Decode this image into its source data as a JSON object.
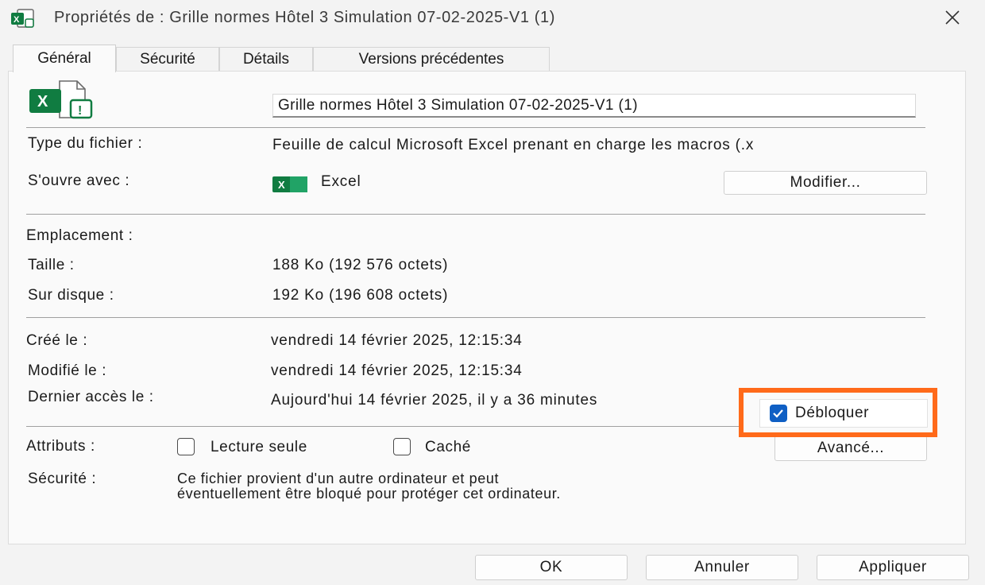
{
  "window": {
    "title": "Propriétés de : Grille normes Hôtel 3 Simulation 07-02-2025-V1 (1)",
    "close_icon": "close-icon",
    "app_icon": "excel-icon"
  },
  "tabs": [
    {
      "label": "Général",
      "active": true
    },
    {
      "label": "Sécurité",
      "active": false
    },
    {
      "label": "Détails",
      "active": false
    },
    {
      "label": "Versions précédentes",
      "active": false
    }
  ],
  "general": {
    "file_name": "Grille normes Hôtel 3 Simulation 07-02-2025-V1 (1)",
    "file_type_label": "Type du fichier :",
    "file_type_value": "Feuille de calcul Microsoft Excel prenant en charge les macros (.x",
    "opens_with_label": "S'ouvre avec :",
    "opens_with_value": "Excel",
    "change_button": "Modifier...",
    "location_label": "Emplacement :",
    "size_label": "Taille :",
    "size_value": "188 Ko (192 576 octets)",
    "size_on_disk_label": "Sur disque :",
    "size_on_disk_value": "192 Ko (196 608 octets)",
    "created_label": "Créé le :",
    "created_value": "vendredi 14 février 2025, 12:15:34",
    "modified_label": "Modifié le :",
    "modified_value": "vendredi 14 février 2025, 12:15:34",
    "accessed_label": "Dernier accès le :",
    "accessed_value": "Aujourd'hui 14 février 2025, il y a 36 minutes",
    "attributes_label": "Attributs :",
    "readonly_label": "Lecture seule",
    "readonly_checked": false,
    "hidden_label": "Caché",
    "hidden_checked": false,
    "advanced_button": "Avancé...",
    "security_label": "Sécurité :",
    "security_text_line1": "Ce fichier provient d'un autre ordinateur et peut",
    "security_text_line2": "éventuellement être bloqué pour protéger cet ordinateur.",
    "unblock_label": "Débloquer",
    "unblock_checked": true
  },
  "footer": {
    "ok": "OK",
    "cancel": "Annuler",
    "apply": "Appliquer"
  },
  "colors": {
    "accent": "#0f5fc4",
    "highlight": "#ff6a1a",
    "excel_green": "#107c41"
  }
}
